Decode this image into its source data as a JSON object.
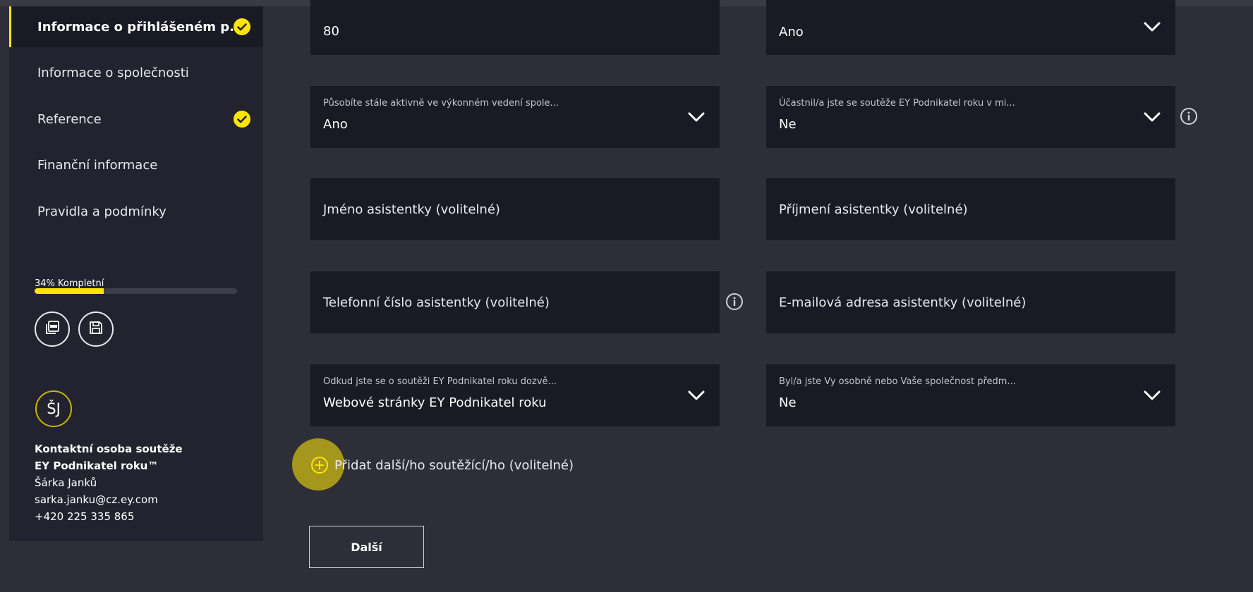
{
  "sidebar": {
    "items": [
      {
        "label": "Informace o přihlášeném p...",
        "completed": true,
        "active": true
      },
      {
        "label": "Informace o společnosti",
        "completed": false,
        "active": false
      },
      {
        "label": "Reference",
        "completed": true,
        "active": false
      },
      {
        "label": "Finanční informace",
        "completed": false,
        "active": false
      },
      {
        "label": "Pravidla a podmínky",
        "completed": false,
        "active": false
      }
    ],
    "progress": {
      "label": "34% Kompletní",
      "percent": 34
    },
    "actions": [
      {
        "icon": "pdf-icon"
      },
      {
        "icon": "save-icon"
      }
    ],
    "contact": {
      "initials": "ŠJ",
      "heading_line1": "Kontaktní osoba soutěže",
      "heading_line2": "EY Podnikatel roku™",
      "name": "Šárka Janků",
      "email": "sarka.janku@cz.ey.com",
      "phone": "+420 225 335 865"
    }
  },
  "form": {
    "row1": {
      "left": {
        "value": "80"
      },
      "right": {
        "value": "Ano"
      }
    },
    "row2": {
      "left": {
        "label": "Působíte stále aktivně ve výkonném vedení spole...",
        "value": "Ano"
      },
      "right": {
        "label": "Účastnil/a jste se soutěže EY Podnikatel roku v mi...",
        "value": "Ne"
      }
    },
    "row3": {
      "left": {
        "placeholder": "Jméno asistentky (volitelné)"
      },
      "right": {
        "placeholder": "Příjmení asistentky (volitelné)"
      }
    },
    "row4": {
      "left": {
        "placeholder": "Telefonní číslo asistentky (volitelné)"
      },
      "right": {
        "placeholder": "E-mailová adresa asistentky (volitelné)"
      }
    },
    "row5": {
      "left": {
        "label": "Odkud jste se o soutěži EY Podnikatel roku dozvě...",
        "value": "Webové stránky EY Podnikatel roku"
      },
      "right": {
        "label": "Byl/a jste Vy osobně nebo Vaše společnost předm...",
        "value": "Ne"
      }
    },
    "add_competitor_label": "Přidat další/ho soutěžící/ho (volitelné)",
    "next_label": "Další"
  },
  "colors": {
    "accent": "#ffe600",
    "background": "#2e2e38",
    "sidebar": "#23232f",
    "field": "#1a1a24"
  }
}
